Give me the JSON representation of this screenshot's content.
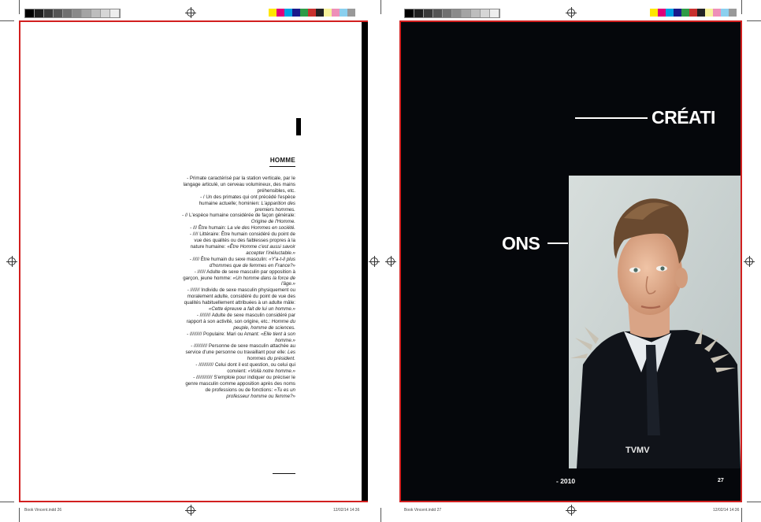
{
  "left_page": {
    "heading": "HOMME",
    "definitions": [
      {
        "plain": "- Primate caractérisé par la station verticale, par le langage articulé, un cerveau volumineux, des mains préhensibles, etc.",
        "italic": ""
      },
      {
        "plain": "- / Un des primates qui ont précédé l'espèce humaine actuelle; hominien:",
        "italic": "L'apparition des premiers hommes."
      },
      {
        "plain": "- // L'espèce humaine considérée de façon générale:",
        "italic": "Origine de l'Homme."
      },
      {
        "plain": "- /// Être humain:",
        "italic": "La vie des Hommes en société."
      },
      {
        "plain": "- //// Littéraire: Être humain considéré du point de vue des qualités ou des faiblesses propres à la nature humaine:",
        "italic": "«Être Homme c'est aussi savoir accepter l'inéluctable.»"
      },
      {
        "plain": "- ///// Être humain du sexe masculin:",
        "italic": "«Y'a-t-il plus d'hommes que de femmes en France?»"
      },
      {
        "plain": "- ////// Adulte de sexe masculin par opposition à garçon, jeune homme:",
        "italic": "«Un homme dans la force de l'âge.»"
      },
      {
        "plain": "- /////// Individu de sexe masculin physiquement ou moralement adulte, considéré du point de vue des qualités habituellement attribuées à un adulte mâle:",
        "italic": "«Cette épreuve a fait de lui un homme.»"
      },
      {
        "plain": "- //////// Adulte de sexe masculin considéré par rapport à son activité, son origine, etc.:",
        "italic": "Homme du peuple, homme de sciences."
      },
      {
        "plain": "- ///////// Populaire: Mari ou Amant:",
        "italic": "«Elle tient à son homme.»"
      },
      {
        "plain": "- ////////// Personne de sexe masculin attachée au service d'une personne ou travaillant pour elle:",
        "italic": "Les hommes du président."
      },
      {
        "plain": "- /////////// Celui dont il est question, ou celui qui convient:",
        "italic": "«Voilà notre homme.»"
      },
      {
        "plain": "- //////////// S'emploie pour indiquer ou préciser le genre masculin comme apposition après des noms de professions ou de fonctions:",
        "italic": "«Tu es un professeur homme ou femme?»"
      }
    ],
    "slug_left": "Book Vincent.indd   26",
    "slug_right": "12/02/14   14:36"
  },
  "right_page": {
    "title_top": "CRÉATI",
    "title_bottom": "ONS",
    "year": "- 2010",
    "page_number": "27",
    "slug_left": "Book Vincent.indd   27",
    "slug_right": "12/02/14   14:36"
  },
  "colors": {
    "trim_border": "#d21f1f",
    "page_dark": "#05070b",
    "text_white": "#ffffff",
    "swatches": [
      "#ffe600",
      "#e0007a",
      "#00a0e4",
      "#1a1a8c",
      "#2e9b46",
      "#c8312e",
      "#232323",
      "#f7f29a",
      "#ee8fb8",
      "#8ad0ef",
      "#999999"
    ]
  }
}
